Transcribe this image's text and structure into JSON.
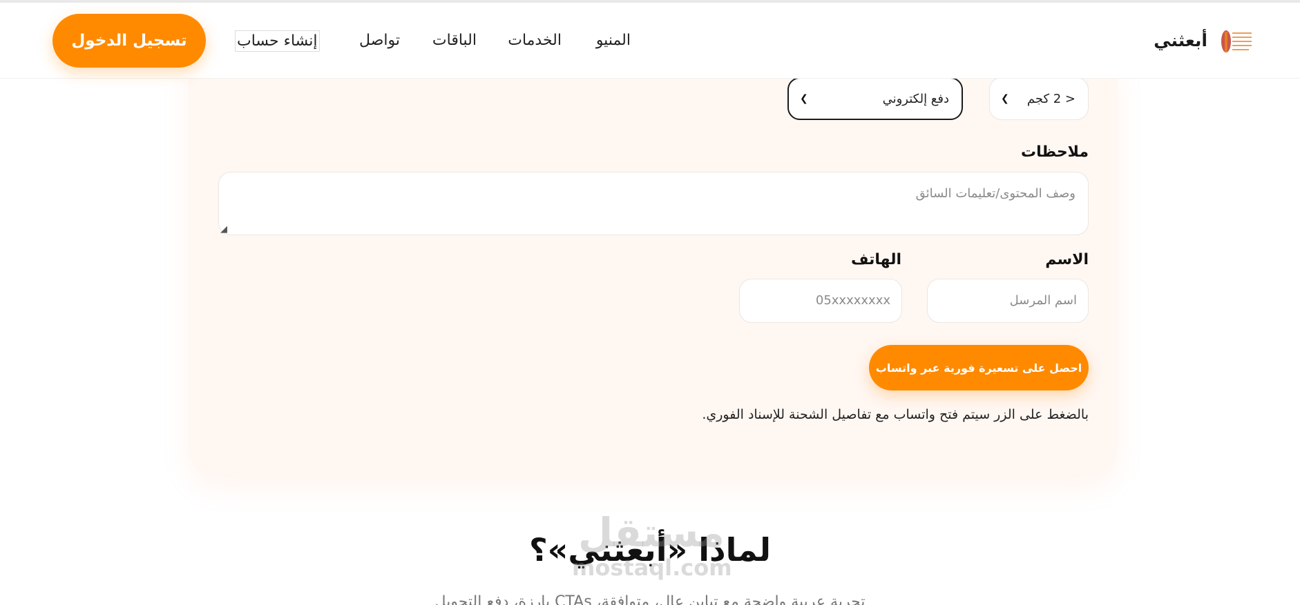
{
  "header": {
    "brand_name": "أبعثني",
    "nav": [
      "المنيو",
      "الخدمات",
      "الباقات",
      "تواصل"
    ],
    "register_label": "إنشاء حساب",
    "login_label": "تسجيل الدخول"
  },
  "form": {
    "weight_select": {
      "value": "< 2 كجم"
    },
    "payment_select": {
      "value": "دفع إلكتروني"
    },
    "notes_label": "ملاحظات",
    "notes_placeholder": "وصف المحتوى/تعليمات السائق",
    "name_label": "الاسم",
    "name_placeholder": "اسم المرسل",
    "phone_label": "الهاتف",
    "phone_placeholder": "05xxxxxxxx",
    "cta_label": "احصل على تسعيرة فورية عبر واتساب",
    "note_text": "بالضغط على الزر سيتم فتح واتساب مع تفاصيل الشحنة للإسناد الفوري."
  },
  "why_section": {
    "title": "لماذا «أبعثني»؟",
    "subtitle": "تجربة عربية واضحة مع تباين عالٍ، متوافقة، CTAs بارزة، دفع التحويل"
  },
  "watermark": {
    "arabic": "مستقل",
    "latin": "mostaql.com"
  },
  "colors": {
    "accent": "#ff8a00",
    "card_bg": "#fff7f2",
    "text": "#1a1a1a"
  },
  "icons": [
    "brand-logo-icon",
    "chevron-down-icon"
  ]
}
